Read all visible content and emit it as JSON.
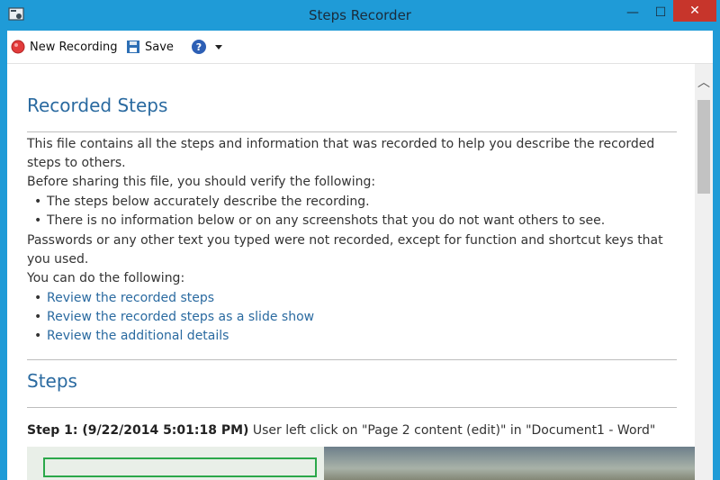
{
  "window": {
    "title": "Steps Recorder"
  },
  "toolbar": {
    "new_recording_label": "New Recording",
    "save_label": "Save"
  },
  "content": {
    "recorded_steps_heading": "Recorded Steps",
    "intro_line": "This file contains all the steps and information that was recorded to help you describe the recorded steps to others.",
    "before_sharing": "Before sharing this file, you should verify the following:",
    "bullets": [
      "The steps below accurately describe the recording.",
      "There is no information below or on any screenshots that you do not want others to see."
    ],
    "passwords_line": "Passwords or any other text you typed were not recorded, except for function and shortcut keys that you used.",
    "you_can": "You can do the following:",
    "links": [
      "Review the recorded steps",
      "Review the recorded steps as a slide show",
      "Review the additional details"
    ],
    "steps_heading": "Steps",
    "step1": {
      "label": "Step 1: (9/22/2014 5:01:18 PM)",
      "text": " User left click on \"Page 2 content (edit)\" in \"Document1 - Word\""
    }
  },
  "icons": {
    "record": "record-icon",
    "save": "floppy-disk-icon",
    "help": "help-icon",
    "dropdown": "chevron-down-icon",
    "app": "steps-recorder-app-icon"
  }
}
